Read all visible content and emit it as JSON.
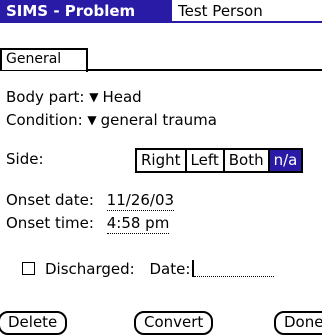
{
  "title": {
    "app": "SIMS - Problem",
    "patient": "Test Person"
  },
  "tabs": [
    {
      "label": "General"
    }
  ],
  "fields": {
    "body_part": {
      "label": "Body part:",
      "value": "Head"
    },
    "condition": {
      "label": "Condition:",
      "value": "general trauma"
    },
    "side": {
      "label": "Side:",
      "options": [
        "Right",
        "Left",
        "Both",
        "n/a"
      ],
      "selected": "n/a"
    },
    "onset_date": {
      "label": "Onset date:",
      "value": "11/26/03"
    },
    "onset_time": {
      "label": "Onset time:",
      "value": "4:58 pm"
    },
    "discharged": {
      "label": "Discharged:",
      "checked": false,
      "date_label": "Date:",
      "date_value": ""
    }
  },
  "buttons": {
    "delete": "Delete",
    "convert": "Convert",
    "done": "Done"
  },
  "colors": {
    "accent": "#2a1ba6"
  }
}
